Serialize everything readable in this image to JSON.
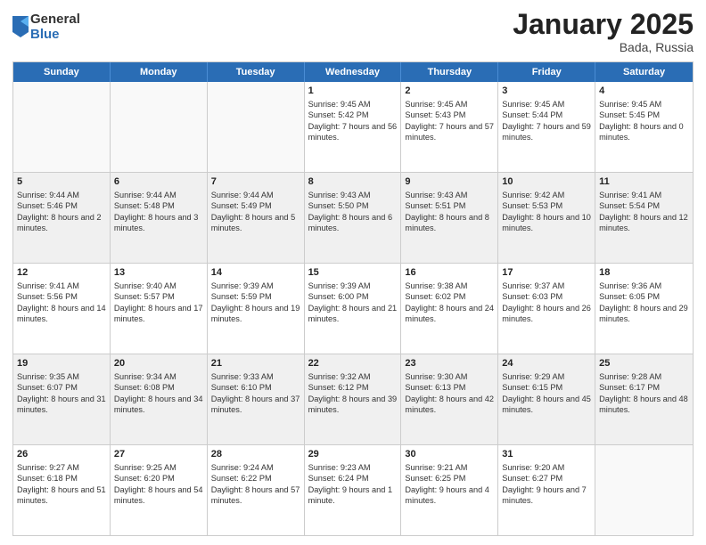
{
  "logo": {
    "general": "General",
    "blue": "Blue"
  },
  "header": {
    "month": "January 2025",
    "location": "Bada, Russia"
  },
  "weekdays": [
    "Sunday",
    "Monday",
    "Tuesday",
    "Wednesday",
    "Thursday",
    "Friday",
    "Saturday"
  ],
  "rows": [
    [
      {
        "day": "",
        "sunrise": "",
        "sunset": "",
        "daylight": "",
        "empty": true
      },
      {
        "day": "",
        "sunrise": "",
        "sunset": "",
        "daylight": "",
        "empty": true
      },
      {
        "day": "",
        "sunrise": "",
        "sunset": "",
        "daylight": "",
        "empty": true
      },
      {
        "day": "1",
        "sunrise": "Sunrise: 9:45 AM",
        "sunset": "Sunset: 5:42 PM",
        "daylight": "Daylight: 7 hours and 56 minutes.",
        "empty": false
      },
      {
        "day": "2",
        "sunrise": "Sunrise: 9:45 AM",
        "sunset": "Sunset: 5:43 PM",
        "daylight": "Daylight: 7 hours and 57 minutes.",
        "empty": false
      },
      {
        "day": "3",
        "sunrise": "Sunrise: 9:45 AM",
        "sunset": "Sunset: 5:44 PM",
        "daylight": "Daylight: 7 hours and 59 minutes.",
        "empty": false
      },
      {
        "day": "4",
        "sunrise": "Sunrise: 9:45 AM",
        "sunset": "Sunset: 5:45 PM",
        "daylight": "Daylight: 8 hours and 0 minutes.",
        "empty": false
      }
    ],
    [
      {
        "day": "5",
        "sunrise": "Sunrise: 9:44 AM",
        "sunset": "Sunset: 5:46 PM",
        "daylight": "Daylight: 8 hours and 2 minutes.",
        "empty": false
      },
      {
        "day": "6",
        "sunrise": "Sunrise: 9:44 AM",
        "sunset": "Sunset: 5:48 PM",
        "daylight": "Daylight: 8 hours and 3 minutes.",
        "empty": false
      },
      {
        "day": "7",
        "sunrise": "Sunrise: 9:44 AM",
        "sunset": "Sunset: 5:49 PM",
        "daylight": "Daylight: 8 hours and 5 minutes.",
        "empty": false
      },
      {
        "day": "8",
        "sunrise": "Sunrise: 9:43 AM",
        "sunset": "Sunset: 5:50 PM",
        "daylight": "Daylight: 8 hours and 6 minutes.",
        "empty": false
      },
      {
        "day": "9",
        "sunrise": "Sunrise: 9:43 AM",
        "sunset": "Sunset: 5:51 PM",
        "daylight": "Daylight: 8 hours and 8 minutes.",
        "empty": false
      },
      {
        "day": "10",
        "sunrise": "Sunrise: 9:42 AM",
        "sunset": "Sunset: 5:53 PM",
        "daylight": "Daylight: 8 hours and 10 minutes.",
        "empty": false
      },
      {
        "day": "11",
        "sunrise": "Sunrise: 9:41 AM",
        "sunset": "Sunset: 5:54 PM",
        "daylight": "Daylight: 8 hours and 12 minutes.",
        "empty": false
      }
    ],
    [
      {
        "day": "12",
        "sunrise": "Sunrise: 9:41 AM",
        "sunset": "Sunset: 5:56 PM",
        "daylight": "Daylight: 8 hours and 14 minutes.",
        "empty": false
      },
      {
        "day": "13",
        "sunrise": "Sunrise: 9:40 AM",
        "sunset": "Sunset: 5:57 PM",
        "daylight": "Daylight: 8 hours and 17 minutes.",
        "empty": false
      },
      {
        "day": "14",
        "sunrise": "Sunrise: 9:39 AM",
        "sunset": "Sunset: 5:59 PM",
        "daylight": "Daylight: 8 hours and 19 minutes.",
        "empty": false
      },
      {
        "day": "15",
        "sunrise": "Sunrise: 9:39 AM",
        "sunset": "Sunset: 6:00 PM",
        "daylight": "Daylight: 8 hours and 21 minutes.",
        "empty": false
      },
      {
        "day": "16",
        "sunrise": "Sunrise: 9:38 AM",
        "sunset": "Sunset: 6:02 PM",
        "daylight": "Daylight: 8 hours and 24 minutes.",
        "empty": false
      },
      {
        "day": "17",
        "sunrise": "Sunrise: 9:37 AM",
        "sunset": "Sunset: 6:03 PM",
        "daylight": "Daylight: 8 hours and 26 minutes.",
        "empty": false
      },
      {
        "day": "18",
        "sunrise": "Sunrise: 9:36 AM",
        "sunset": "Sunset: 6:05 PM",
        "daylight": "Daylight: 8 hours and 29 minutes.",
        "empty": false
      }
    ],
    [
      {
        "day": "19",
        "sunrise": "Sunrise: 9:35 AM",
        "sunset": "Sunset: 6:07 PM",
        "daylight": "Daylight: 8 hours and 31 minutes.",
        "empty": false
      },
      {
        "day": "20",
        "sunrise": "Sunrise: 9:34 AM",
        "sunset": "Sunset: 6:08 PM",
        "daylight": "Daylight: 8 hours and 34 minutes.",
        "empty": false
      },
      {
        "day": "21",
        "sunrise": "Sunrise: 9:33 AM",
        "sunset": "Sunset: 6:10 PM",
        "daylight": "Daylight: 8 hours and 37 minutes.",
        "empty": false
      },
      {
        "day": "22",
        "sunrise": "Sunrise: 9:32 AM",
        "sunset": "Sunset: 6:12 PM",
        "daylight": "Daylight: 8 hours and 39 minutes.",
        "empty": false
      },
      {
        "day": "23",
        "sunrise": "Sunrise: 9:30 AM",
        "sunset": "Sunset: 6:13 PM",
        "daylight": "Daylight: 8 hours and 42 minutes.",
        "empty": false
      },
      {
        "day": "24",
        "sunrise": "Sunrise: 9:29 AM",
        "sunset": "Sunset: 6:15 PM",
        "daylight": "Daylight: 8 hours and 45 minutes.",
        "empty": false
      },
      {
        "day": "25",
        "sunrise": "Sunrise: 9:28 AM",
        "sunset": "Sunset: 6:17 PM",
        "daylight": "Daylight: 8 hours and 48 minutes.",
        "empty": false
      }
    ],
    [
      {
        "day": "26",
        "sunrise": "Sunrise: 9:27 AM",
        "sunset": "Sunset: 6:18 PM",
        "daylight": "Daylight: 8 hours and 51 minutes.",
        "empty": false
      },
      {
        "day": "27",
        "sunrise": "Sunrise: 9:25 AM",
        "sunset": "Sunset: 6:20 PM",
        "daylight": "Daylight: 8 hours and 54 minutes.",
        "empty": false
      },
      {
        "day": "28",
        "sunrise": "Sunrise: 9:24 AM",
        "sunset": "Sunset: 6:22 PM",
        "daylight": "Daylight: 8 hours and 57 minutes.",
        "empty": false
      },
      {
        "day": "29",
        "sunrise": "Sunrise: 9:23 AM",
        "sunset": "Sunset: 6:24 PM",
        "daylight": "Daylight: 9 hours and 1 minute.",
        "empty": false
      },
      {
        "day": "30",
        "sunrise": "Sunrise: 9:21 AM",
        "sunset": "Sunset: 6:25 PM",
        "daylight": "Daylight: 9 hours and 4 minutes.",
        "empty": false
      },
      {
        "day": "31",
        "sunrise": "Sunrise: 9:20 AM",
        "sunset": "Sunset: 6:27 PM",
        "daylight": "Daylight: 9 hours and 7 minutes.",
        "empty": false
      },
      {
        "day": "",
        "sunrise": "",
        "sunset": "",
        "daylight": "",
        "empty": true
      }
    ]
  ]
}
